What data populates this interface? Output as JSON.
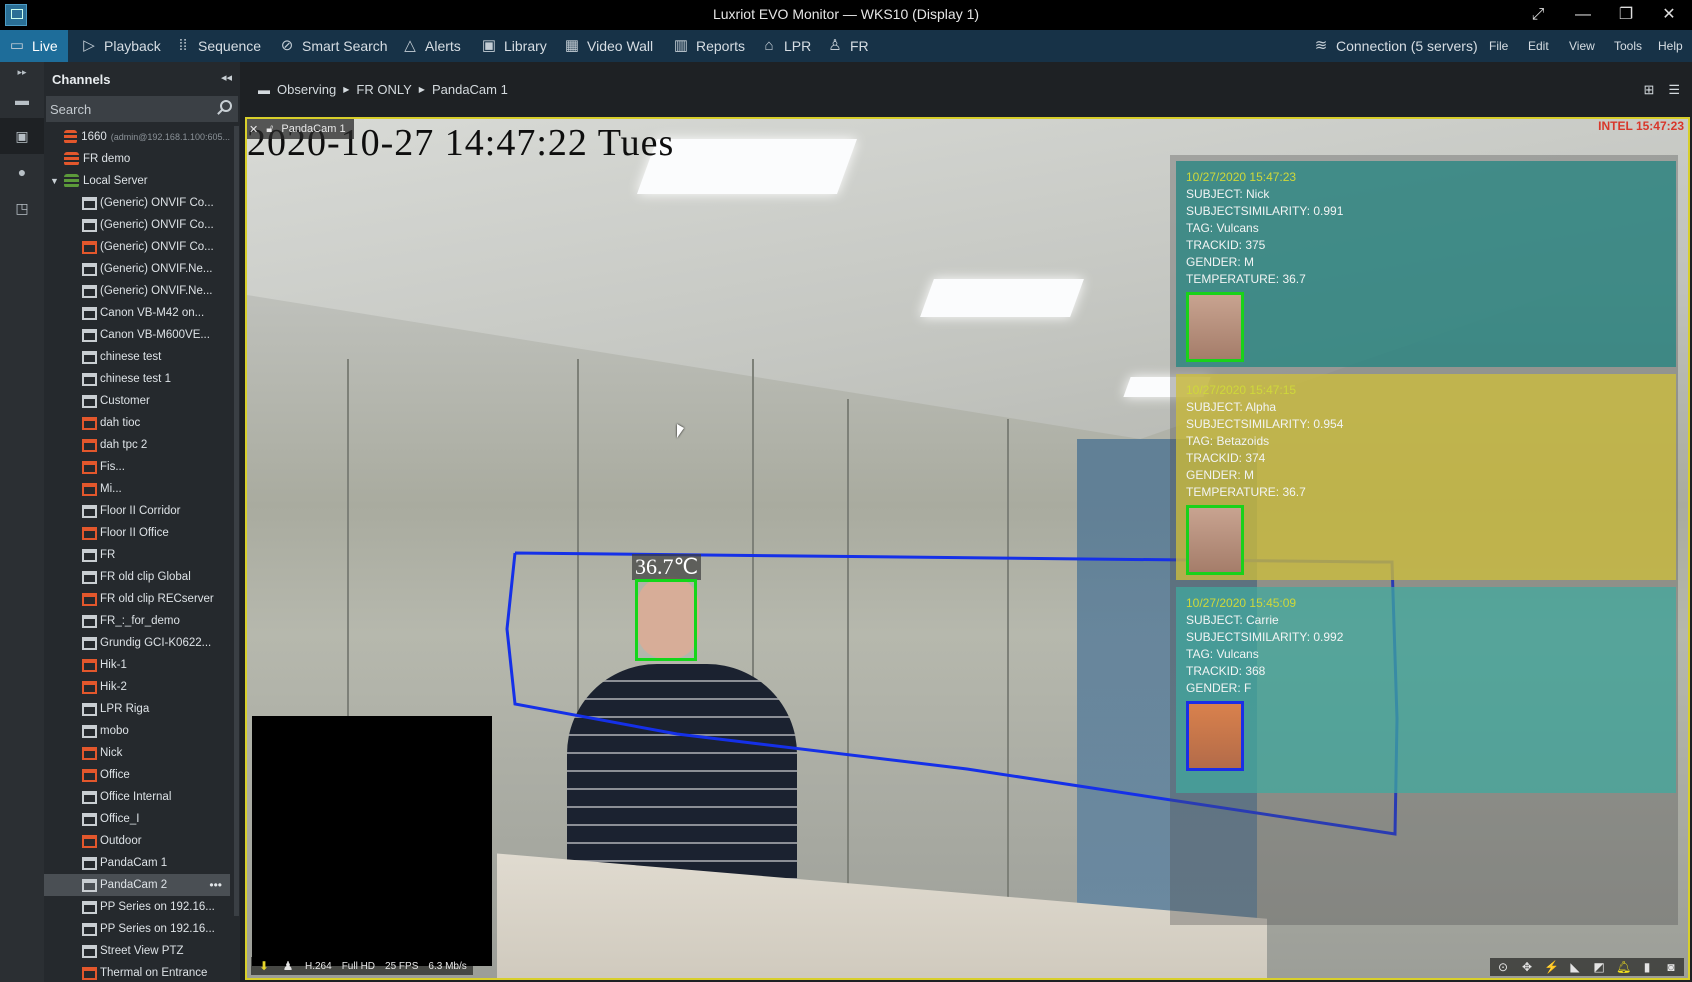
{
  "window": {
    "title": "Luxriot EVO Monitor — WKS10 (Display 1)",
    "controls": [
      "expand",
      "minimize",
      "restore",
      "close"
    ]
  },
  "menubar": {
    "nav": [
      {
        "label": "Live",
        "icon": "monitor-icon",
        "active": true
      },
      {
        "label": "Playback",
        "icon": "play-icon"
      },
      {
        "label": "Sequence",
        "icon": "sequence-icon"
      },
      {
        "label": "Smart Search",
        "icon": "smart-search-icon"
      },
      {
        "label": "Alerts",
        "icon": "bell-icon"
      },
      {
        "label": "Library",
        "icon": "library-icon"
      },
      {
        "label": "Video Wall",
        "icon": "grid-icon"
      },
      {
        "label": "Reports",
        "icon": "chart-icon"
      },
      {
        "label": "LPR",
        "icon": "car-icon"
      },
      {
        "label": "FR",
        "icon": "person-icon"
      }
    ],
    "connection": "Connection (5 servers)",
    "menus": [
      "File",
      "Edit",
      "View",
      "Tools",
      "Help"
    ]
  },
  "channels": {
    "title": "Channels",
    "search_placeholder": "Search",
    "items": [
      {
        "label": "1660",
        "sub": "(admin@192.168.1.100:605...",
        "type": "server",
        "status": "red",
        "level": 0
      },
      {
        "label": "FR demo",
        "type": "server",
        "status": "red",
        "level": 0
      },
      {
        "label": "Local Server",
        "type": "server",
        "status": "green",
        "level": 0,
        "expanded": true
      },
      {
        "label": "(Generic) ONVIF Co...",
        "type": "camera",
        "status": "ok",
        "level": 1
      },
      {
        "label": "(Generic) ONVIF Co...",
        "type": "camera",
        "status": "ok",
        "level": 1
      },
      {
        "label": "(Generic) ONVIF Co...",
        "type": "camera",
        "status": "red",
        "level": 1
      },
      {
        "label": "(Generic) ONVIF.Ne...",
        "type": "camera",
        "status": "ok",
        "level": 1
      },
      {
        "label": "(Generic) ONVIF.Ne...",
        "type": "camera",
        "status": "ok",
        "level": 1
      },
      {
        "label": "Canon VB-M42 on...",
        "type": "camera",
        "status": "ok",
        "level": 1
      },
      {
        "label": "Canon VB-M600VE...",
        "type": "camera",
        "status": "ok",
        "level": 1
      },
      {
        "label": "chinese test",
        "type": "camera",
        "status": "ok",
        "level": 1
      },
      {
        "label": "chinese test 1",
        "type": "camera",
        "status": "ok",
        "level": 1
      },
      {
        "label": "Customer",
        "type": "camera",
        "status": "ok",
        "level": 1
      },
      {
        "label": "dah tioc",
        "type": "camera",
        "status": "red",
        "level": 1
      },
      {
        "label": "dah tpc 2",
        "type": "camera",
        "status": "red",
        "level": 1
      },
      {
        "label": "Fis...",
        "type": "camera",
        "status": "red",
        "level": 1
      },
      {
        "label": "Mi...",
        "type": "camera",
        "status": "red",
        "level": 1
      },
      {
        "label": "Floor II Corridor",
        "type": "camera",
        "status": "ok",
        "level": 1
      },
      {
        "label": "Floor II Office",
        "type": "camera",
        "status": "red",
        "level": 1
      },
      {
        "label": "FR",
        "type": "camera",
        "status": "ok",
        "level": 1
      },
      {
        "label": "FR old clip Global",
        "type": "camera",
        "status": "ok",
        "level": 1
      },
      {
        "label": "FR old clip RECserver",
        "type": "camera",
        "status": "red",
        "level": 1
      },
      {
        "label": "FR_:_for_demo",
        "type": "camera",
        "status": "ok",
        "level": 1
      },
      {
        "label": "Grundig GCI-K0622...",
        "type": "camera",
        "status": "ok",
        "level": 1
      },
      {
        "label": "Hik-1",
        "type": "camera",
        "status": "red",
        "level": 1
      },
      {
        "label": "Hik-2",
        "type": "camera",
        "status": "red",
        "level": 1
      },
      {
        "label": "LPR Riga",
        "type": "camera",
        "status": "ok",
        "level": 1
      },
      {
        "label": "mobo",
        "type": "camera",
        "status": "ok",
        "level": 1
      },
      {
        "label": "Nick",
        "type": "camera",
        "status": "red",
        "level": 1
      },
      {
        "label": "Office",
        "type": "camera",
        "status": "red",
        "level": 1
      },
      {
        "label": "Office Internal",
        "type": "camera",
        "status": "ok",
        "level": 1
      },
      {
        "label": "Office_I",
        "type": "camera",
        "status": "ok",
        "level": 1
      },
      {
        "label": "Outdoor",
        "type": "camera",
        "status": "red",
        "level": 1
      },
      {
        "label": "PandaCam 1",
        "type": "camera",
        "status": "ok",
        "level": 1
      },
      {
        "label": "PandaCam 2",
        "type": "camera",
        "status": "ok",
        "level": 1,
        "selected": true
      },
      {
        "label": "PP Series on 192.16...",
        "type": "camera",
        "status": "ok",
        "level": 1
      },
      {
        "label": "PP Series on 192.16...",
        "type": "camera",
        "status": "ok",
        "level": 1
      },
      {
        "label": "Street View PTZ",
        "type": "camera",
        "status": "ok",
        "level": 1
      },
      {
        "label": "Thermal on Entrance",
        "type": "camera",
        "status": "red",
        "level": 1
      }
    ]
  },
  "breadcrumb": [
    "Observing",
    "FR ONLY",
    "PandaCam 1"
  ],
  "video": {
    "tab_label": "PandaCam 1",
    "osd_timestamp": "2020-10-27 14:47:22 Tues",
    "osd_right": "INTEL 15:47:23",
    "temperature_label": "36.7℃",
    "stream": {
      "codec": "H.264",
      "resolution": "Full HD",
      "fps": "25 FPS",
      "bitrate": "6.3 Mb/s"
    },
    "toolbar_icons": [
      "playback-icon",
      "ptz-icon",
      "motion-icon",
      "fisheye-icon",
      "edit-icon",
      "alarm-bell-icon",
      "bookmark-icon",
      "snapshot-icon"
    ]
  },
  "fr_events": [
    {
      "time": "10/27/2020 15:47:23",
      "lines": [
        "SUBJECT: Nick",
        "SUBJECTSIMILARITY: 0.991",
        "TAG: Vulcans",
        "TRACKID: 375",
        "GENDER: M",
        "TEMPERATURE: 36.7"
      ],
      "color": "#1d8480",
      "box_color": "#19d21a"
    },
    {
      "time": "10/27/2020 15:47:15",
      "lines": [
        "SUBJECT: Alpha",
        "SUBJECTSIMILARITY: 0.954",
        "TAG: Betazoids",
        "TRACKID: 374",
        "GENDER: M",
        "TEMPERATURE: 36.7"
      ],
      "color": "#cdbe3c",
      "box_color": "#19d21a"
    },
    {
      "time": "10/27/2020 15:45:09",
      "lines": [
        "SUBJECT: Carrie",
        "SUBJECTSIMILARITY: 0.992",
        "TAG: Vulcans",
        "TRACKID: 368",
        "GENDER: F"
      ],
      "color": "#3eaaa0",
      "box_color": "#1b2ee6"
    }
  ],
  "colors": {
    "accent": "#1e6d9a",
    "menubar": "#173247",
    "selection_border": "#d8cf2a",
    "zone_line": "#1530e8",
    "face_box": "#14d61a",
    "offline": "#e3572c"
  }
}
